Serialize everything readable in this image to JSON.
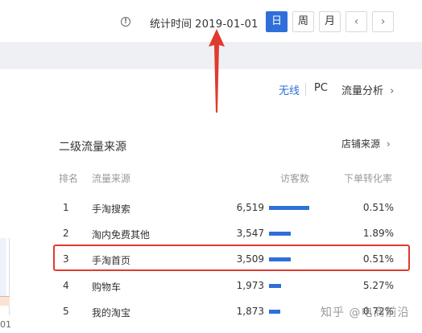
{
  "header": {
    "info_icon": "info-icon",
    "stat_time_label": "统计时间",
    "stat_date": "2019-01-01",
    "periods": [
      "日",
      "周",
      "月"
    ],
    "active_period": "日",
    "prev_icon": "chevron-left-icon",
    "next_icon": "chevron-right-icon"
  },
  "device_tabs": {
    "items": [
      "无线",
      "PC"
    ],
    "active": "无线",
    "flow_analysis_label": "流量分析",
    "flow_analysis_icon": "chevron-right-icon"
  },
  "chart_stub": {
    "tick_label": "01"
  },
  "secondary_sources": {
    "title": "二级流量来源",
    "shop_source_label": "店铺来源",
    "columns": [
      "排名",
      "流量来源",
      "访客数",
      "下单转化率"
    ],
    "rows": [
      {
        "rank": "1",
        "source": "手淘搜索",
        "visitors": "6,519",
        "visitors_value": 6519,
        "conversion": "0.51%"
      },
      {
        "rank": "2",
        "source": "淘内免费其他",
        "visitors": "3,547",
        "visitors_value": 3547,
        "conversion": "1.89%"
      },
      {
        "rank": "3",
        "source": "手淘首页",
        "visitors": "3,509",
        "visitors_value": 3509,
        "conversion": "0.51%"
      },
      {
        "rank": "4",
        "source": "购物车",
        "visitors": "1,973",
        "visitors_value": 1973,
        "conversion": "5.27%"
      },
      {
        "rank": "5",
        "source": "我的淘宝",
        "visitors": "1,873",
        "visitors_value": 1873,
        "conversion": "0.72%"
      }
    ],
    "highlighted_rank": "3"
  },
  "colors": {
    "accent": "#2f6fd9",
    "annotation_red": "#e03a2f"
  },
  "watermark": "知乎 @电商前沿"
}
